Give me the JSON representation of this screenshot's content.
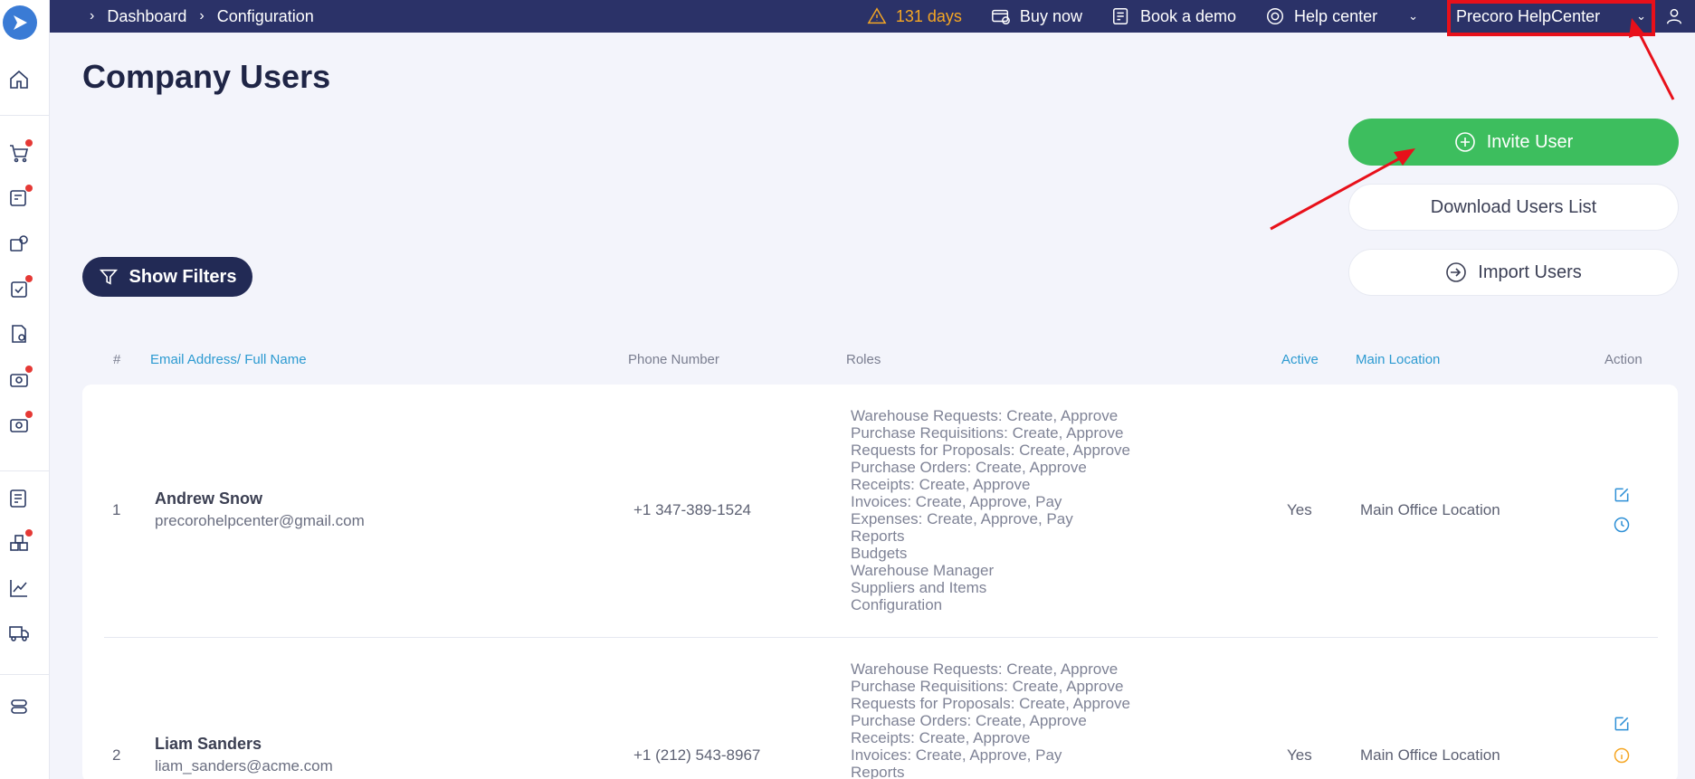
{
  "topbar": {
    "breadcrumbs": [
      "Dashboard",
      "Configuration"
    ],
    "trial": "131 days",
    "buy_now": "Buy now",
    "book_demo": "Book a demo",
    "help_center": "Help center",
    "company": "Precoro HelpCenter"
  },
  "page": {
    "title": "Company Users",
    "invite_button": "Invite User",
    "download_button": "Download Users List",
    "import_button": "Import Users",
    "filters_button": "Show Filters"
  },
  "table": {
    "headers": [
      "#",
      "Email Address/ Full Name",
      "Phone Number",
      "Roles",
      "Active",
      "Main Location",
      "Action"
    ],
    "rows": [
      {
        "num": "1",
        "name": "Andrew Snow",
        "email": "precorohelpcenter@gmail.com",
        "phone": "+1 347-389-1524",
        "roles": [
          "Warehouse Requests: Create, Approve",
          "Purchase Requisitions: Create, Approve",
          "Requests for Proposals: Create, Approve",
          "Purchase Orders: Create, Approve",
          "Receipts: Create, Approve",
          "Invoices: Create, Approve, Pay",
          "Expenses: Create, Approve, Pay",
          "Reports",
          "Budgets",
          "Warehouse Manager",
          "Suppliers and Items",
          "Configuration"
        ],
        "active": "Yes",
        "location": "Main Office Location"
      },
      {
        "num": "2",
        "name": "Liam Sanders",
        "email": "liam_sanders@acme.com",
        "phone": "+1 (212) 543-8967",
        "roles": [
          "Warehouse Requests: Create, Approve",
          "Purchase Requisitions: Create, Approve",
          "Requests for Proposals: Create, Approve",
          "Purchase Orders: Create, Approve",
          "Receipts: Create, Approve",
          "Invoices: Create, Approve, Pay",
          "Reports"
        ],
        "active": "Yes",
        "location": "Main Office Location"
      }
    ]
  },
  "colors": {
    "topbar": "#2b3268",
    "accent_green": "#3dbe5e",
    "header_blue": "#2c9ad1",
    "highlight_red": "#e8101a"
  }
}
